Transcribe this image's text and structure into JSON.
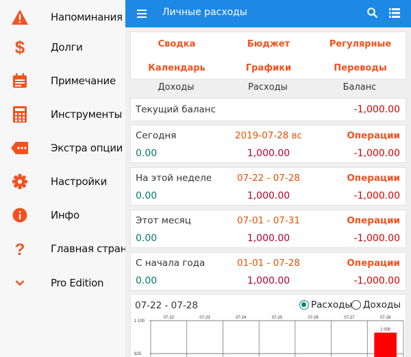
{
  "drawer": {
    "items": [
      {
        "label": "Напоминания",
        "icon": "warning-icon"
      },
      {
        "label": "Долги",
        "icon": "dollar-icon"
      },
      {
        "label": "Примечание",
        "icon": "calendar-note-icon"
      },
      {
        "label": "Инструменты",
        "icon": "calculator-icon"
      },
      {
        "label": "Экстра опции",
        "icon": "tag-icon"
      },
      {
        "label": "Настройки",
        "icon": "gear-icon"
      },
      {
        "label": "Инфо",
        "icon": "info-icon"
      },
      {
        "label": "Главная страница",
        "icon": "question-icon"
      },
      {
        "label": "Pro Edition",
        "icon": "chevron-down-icon"
      }
    ]
  },
  "appbar": {
    "title": "Личные расходы"
  },
  "nav": {
    "summary": "Сводка",
    "budget": "Бюджет",
    "recurring": "Регулярные",
    "calendar": "Календарь",
    "charts": "Графики",
    "transfers": "Переводы"
  },
  "columns": {
    "income": "Доходы",
    "expenses": "Расходы",
    "balance": "Баланс"
  },
  "current_balance": {
    "label": "Текущий баланс",
    "value": "-1,000.00"
  },
  "periods": [
    {
      "label": "Сегодня",
      "range": "2019-07-28 вс",
      "ops": "Операции",
      "income": "0.00",
      "expenses": "1,000.00",
      "balance": "-1,000.00"
    },
    {
      "label": "На этой неделе",
      "range": "07-22 - 07-28",
      "ops": "Операции",
      "income": "0.00",
      "expenses": "1,000.00",
      "balance": "-1,000.00"
    },
    {
      "label": "Этот месяц",
      "range": "07-01 - 07-31",
      "ops": "Операции",
      "income": "0.00",
      "expenses": "1,000.00",
      "balance": "-1,000.00"
    },
    {
      "label": "С начала года",
      "range": "01-01 - 07-28",
      "ops": "Операции",
      "income": "0.00",
      "expenses": "1,000.00",
      "balance": "-1,000.00"
    }
  ],
  "chart": {
    "range": "07-22 - 07-28",
    "radio_expenses": "Расходы",
    "radio_income": "Доходы",
    "selected": "expenses"
  },
  "colors": {
    "accent": "#1e88e5",
    "drawer_icons": "#f4511e",
    "link": "#f4511e",
    "bar": "#ff0000"
  },
  "chart_data": {
    "type": "bar",
    "categories": [
      "07-22",
      "07-23",
      "07-24",
      "07-25",
      "07-26",
      "07-27",
      "07-28"
    ],
    "values": [
      0,
      0,
      0,
      0,
      0,
      0,
      1000
    ],
    "value_labels": [
      "",
      "",
      "",
      "",
      "",
      "",
      "1 000"
    ],
    "y_ticks": [
      "1 100",
      "825"
    ],
    "ylim": [
      0,
      1100
    ],
    "grid": true
  }
}
